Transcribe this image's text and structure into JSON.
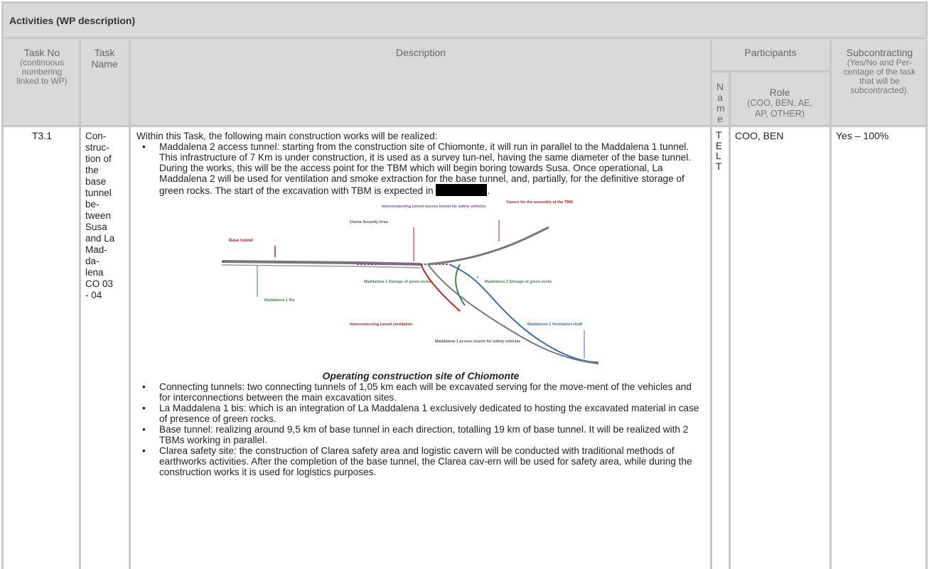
{
  "section_title": "Activities (WP description)",
  "headers": {
    "task_no": "Task No",
    "task_no_sub": "(continuous numbering linked to WP)",
    "task_name": "Task Name",
    "description": "Description",
    "participants": "Participants",
    "name": "Name",
    "role": "Role",
    "role_sub": "(COO, BEN, AE, AP, OTHER)",
    "subcontracting": "Subcontracting",
    "subcontracting_sub": "(Yes/No and Per-centage of the task that will be subcontracted)."
  },
  "row": {
    "task_no": "T3.1",
    "task_name": "Con-struc-tion of the base tunnel be-tween Susa and La Mad-da-lena CO 03 - 04",
    "name": "TELT",
    "role": "COO, BEN",
    "subcontracting": "Yes – 100%",
    "intro": "Within this Task, the following main construction works will be realized:",
    "bullet1_a": "Maddalena 2 access tunnel: starting from the construction site of Chiomonte, it will run in parallel to the Maddalena 1 tunnel. This infrastructure of 7 Km is under construction, it is used as a survey tun-nel, having the same diameter of the base tunnel. During the works, this will be the access point for the TBM which will begin boring towards Susa. Once operational, La Maddalena 2 will be used for ventilation and smoke extraction for the base tunnel, and, partially, for the definitive storage of green rocks. The start of the excavation with TBM is expected in",
    "bullet1_b": ".",
    "caption": "Operating construction site of Chiomonte",
    "bullets": [
      "Connecting tunnels: two connecting tunnels of 1,05 km each will be excavated serving for the move-ment of the vehicles and for interconnections between the main excavation sites.",
      "La Maddalena 1 bis: which is an integration of La Maddalena 1 exclusively dedicated to hosting the excavated material in case of presence of green rocks.",
      "Base tunnel: realizing around 9,5 km of base tunnel in each direction, totalling 19 km of base tunnel. It will be realized with 2 TBMs working in parallel.",
      "Clarea safety site: the construction of Clarea safety area and logistic cavern will be conducted with traditional methods of earthworks activities. After the completion of the base tunnel, the Clarea cav-ern will be used for safety area, while during the construction works it is used for logistics purposes."
    ]
  },
  "figure_labels": {
    "base_tunnel": "Base tunnel",
    "clarea": "Clarea Security Area",
    "interconnect_access": "Interconnecting tunnel access tunnel for safety vehicles",
    "cavern": "Cavern for the assembly of the TBM",
    "m1_storage": "Maddalena 1 Storage of green rocks",
    "m2_storage": "Maddalena 2 Storage of green rocks",
    "m1bis": "Maddalena 1 Bis",
    "interconnect_vent": "Interconnecting tunnel ventilation",
    "m2_vent": "Maddalena 2 Ventilation shaft",
    "m1_access": "Maddalena 1 access tunnel for safety vehicles"
  }
}
